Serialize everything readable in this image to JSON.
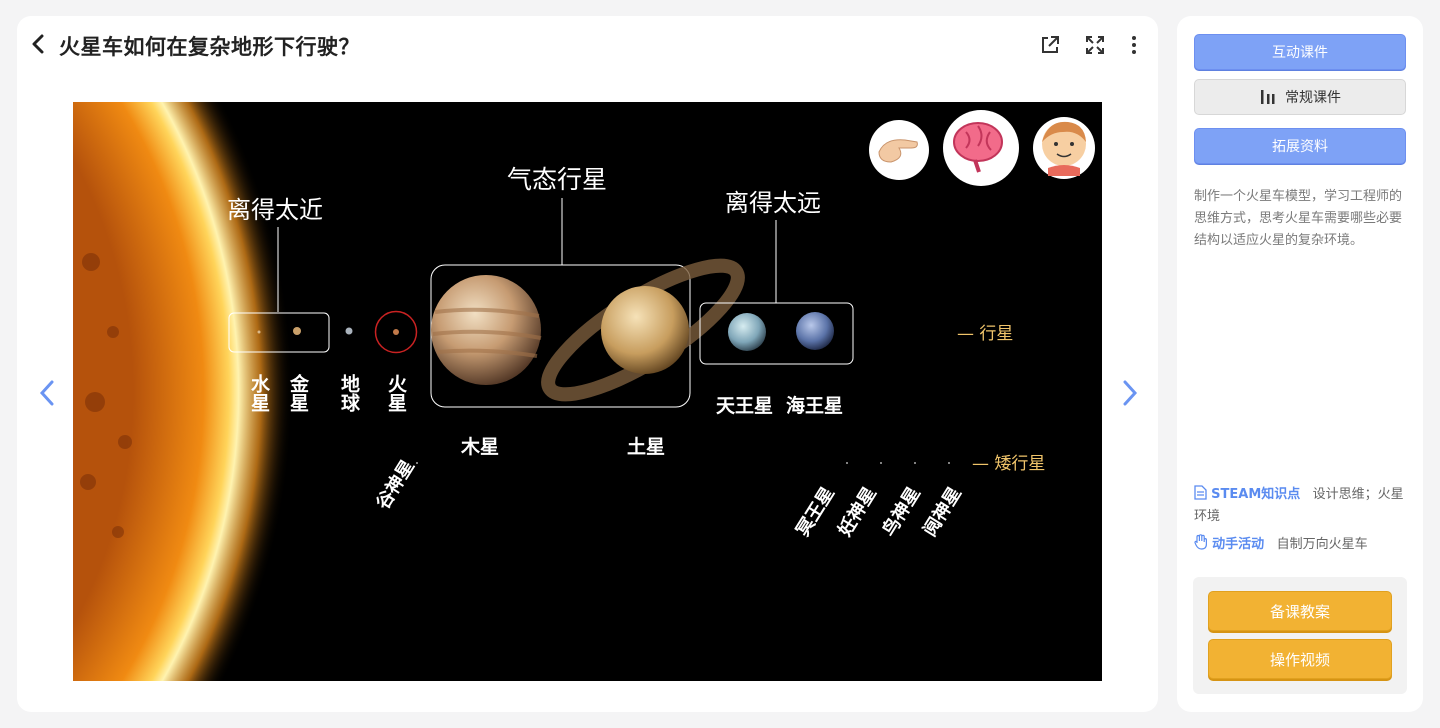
{
  "header": {
    "title": "火星车如何在复杂地形下行驶？"
  },
  "slide": {
    "too_close_label": "离得太近",
    "gas_planets_label": "气态行星",
    "too_far_label": "离得太远",
    "planet_category_label": "— 行星",
    "dwarf_category_label": "— 矮行星",
    "mercury": "水星",
    "venus": "金星",
    "earth": "地球",
    "mars": "火星",
    "jupiter": "木星",
    "saturn": "土星",
    "uranus": "天王星",
    "neptune": "海王星",
    "ceres": "谷神星",
    "pluto": "冥王星",
    "haumea": "妊神星",
    "makemake": "鸟神星",
    "eris": "阋神星"
  },
  "sidebar": {
    "interactive_label": "互动课件",
    "regular_label": "常规课件",
    "extended_label": "拓展资料",
    "description": "制作一个火星车模型，学习工程师的思维方式，思考火星车需要哪些必要结构以适应火星的复杂环境。",
    "steam_label": "STEAM知识点",
    "steam_value": "设计思维；火星环境",
    "activity_label": "动手活动",
    "activity_value": "自制万向火星车",
    "lesson_plan_label": "备课教案",
    "video_label": "操作视频"
  },
  "colors": {
    "accent_blue": "#7ea2f6",
    "accent_orange": "#f2b233",
    "category_gold": "#f0c46a"
  }
}
